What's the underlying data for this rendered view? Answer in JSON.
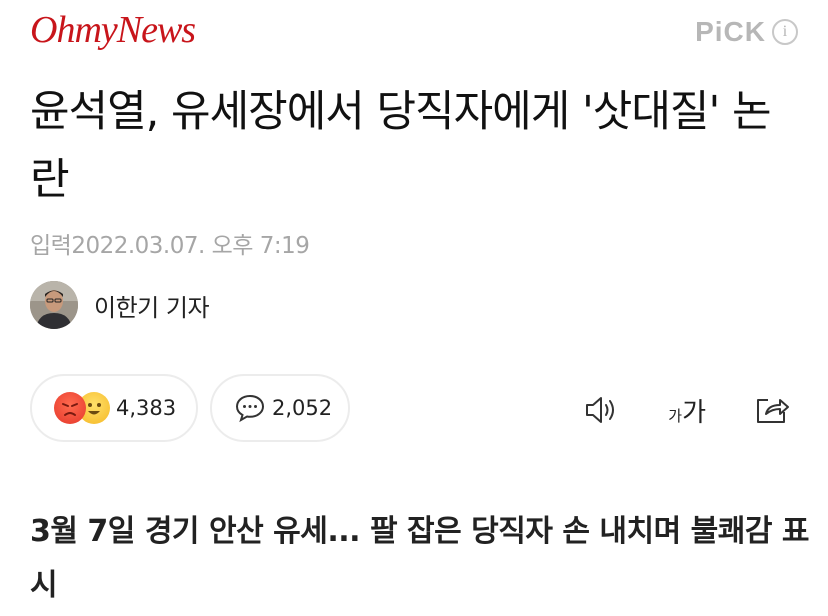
{
  "header": {
    "logo": "OhmyNews",
    "pick_label": "PiCK",
    "info_glyph": "i",
    "icons": {
      "info": "info-icon"
    }
  },
  "article": {
    "title": "윤석열, 유세장에서 당직자에게 '삿대질' 논란",
    "published": "입력2022.03.07. 오후 7:19",
    "reporter": "이한기 기자",
    "subtitle": "3월 7일 경기 안산 유세... 팔 잡은 당직자 손 내치며 불쾌감 표시"
  },
  "actions": {
    "reaction_count": "4,383",
    "comment_count": "2,052",
    "font_size_small": "가",
    "font_size_large": "가",
    "icons": {
      "reaction": [
        "angry-face-icon",
        "smiling-face-icon"
      ],
      "comment": "speech-bubble-icon",
      "audio": "speaker-icon",
      "share": "share-icon"
    }
  },
  "colors": {
    "brand": "#c8151b",
    "pick": "#b7b7b7",
    "muted_text": "#a6a6a6",
    "pill_border": "#ececec"
  }
}
